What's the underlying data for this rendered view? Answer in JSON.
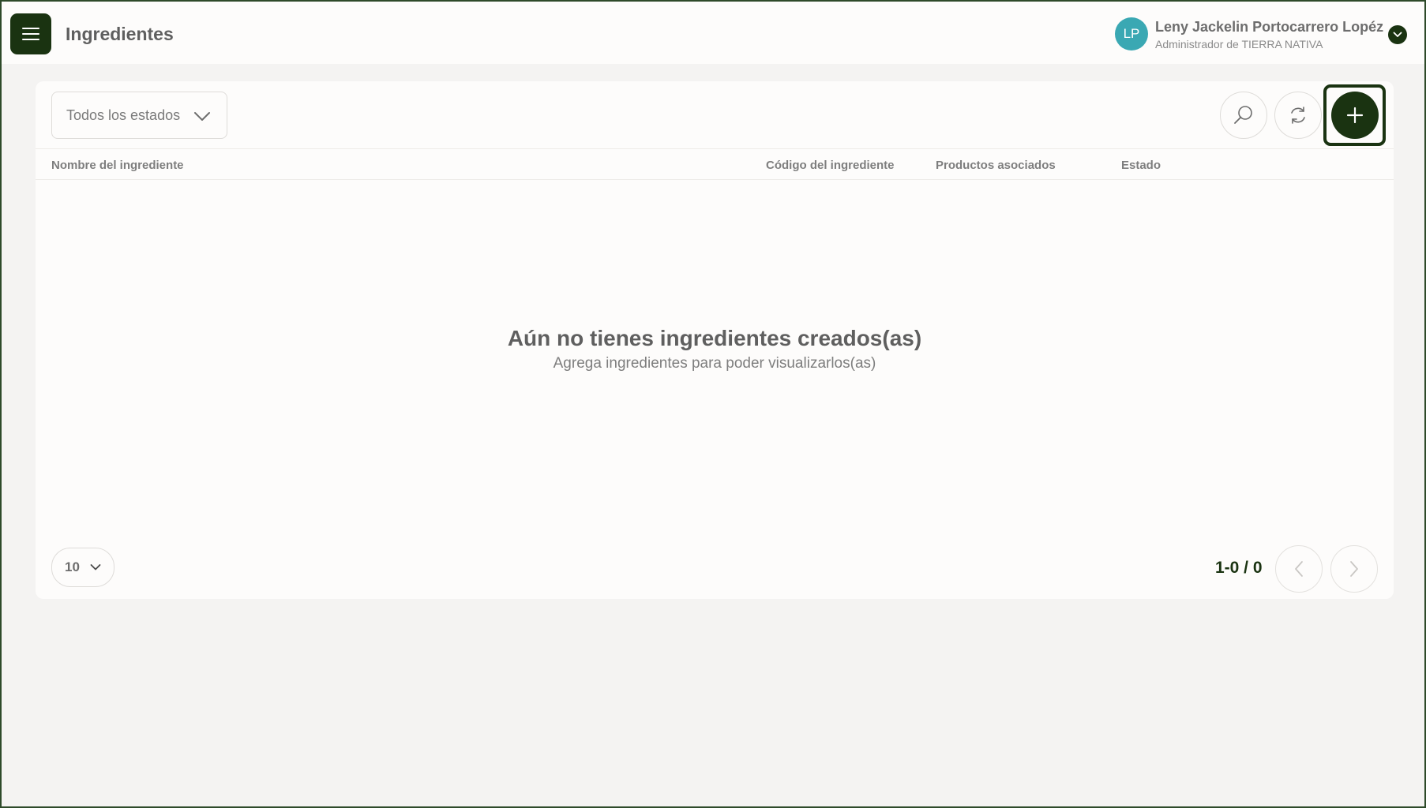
{
  "header": {
    "title": "Ingredientes",
    "menu_icon": "hamburger-menu-icon",
    "user": {
      "initials": "LP",
      "name": "Leny Jackelin Portocarrero Lopéz",
      "role": "Administrador de TIERRA NATIVA",
      "avatar_color": "#3aa8b3"
    }
  },
  "toolbar": {
    "status_filter": "Todos los estados",
    "search_icon": "search-icon",
    "refresh_icon": "refresh-icon",
    "add_icon": "plus-icon"
  },
  "table": {
    "columns": [
      "Nombre del ingrediente",
      "Código del ingrediente",
      "Productos asociados",
      "Estado"
    ],
    "rows": []
  },
  "empty_state": {
    "title": "Aún no tienes ingredientes creados(as)",
    "subtitle": "Agrega ingredientes para poder visualizarlos(as)"
  },
  "pagination": {
    "page_size": "10",
    "range": "1-0 / 0"
  },
  "colors": {
    "brand_dark": "#1a3311",
    "background": "#f4f3f2",
    "card": "#fdfcfb"
  }
}
